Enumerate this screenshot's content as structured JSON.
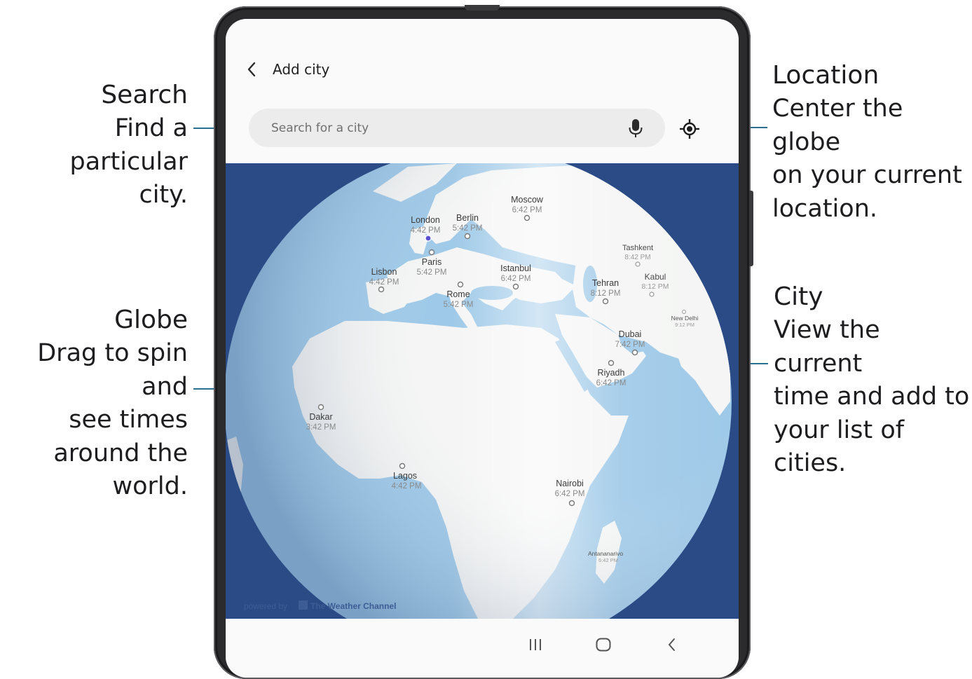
{
  "callouts": {
    "search": {
      "title": "Search",
      "desc1": "Find a particular",
      "desc2": "city."
    },
    "globe": {
      "title": "Globe",
      "desc1": "Drag to spin and",
      "desc2": "see times",
      "desc3": "around the",
      "desc4": "world."
    },
    "location": {
      "title": "Location",
      "desc1": "Center the globe",
      "desc2": "on your current",
      "desc3": "location."
    },
    "city": {
      "title": "City",
      "desc1": "View the current",
      "desc2": "time and add to",
      "desc3": "your list of",
      "desc4": "cities."
    }
  },
  "app": {
    "title": "Add city",
    "search_placeholder": "Search for a city",
    "powered_by": "powered by",
    "brand": "The Weather Channel"
  },
  "cities": [
    {
      "name": "Moscow",
      "time": "6:42 PM"
    },
    {
      "name": "London",
      "time": "4:42 PM"
    },
    {
      "name": "Berlin",
      "time": "5:42 PM"
    },
    {
      "name": "Tashkent",
      "time": "8:42 PM"
    },
    {
      "name": "Paris",
      "time": "5:42 PM"
    },
    {
      "name": "Lisbon",
      "time": "4:42 PM"
    },
    {
      "name": "Istanbul",
      "time": "6:42 PM"
    },
    {
      "name": "Kabul",
      "time": "8:12 PM"
    },
    {
      "name": "Tehran",
      "time": "8:12 PM"
    },
    {
      "name": "Rome",
      "time": "5:42 PM"
    },
    {
      "name": "New Delhi",
      "time": "9:12 PM"
    },
    {
      "name": "Dubai",
      "time": "7:42 PM"
    },
    {
      "name": "Riyadh",
      "time": "6:42 PM"
    },
    {
      "name": "Dakar",
      "time": "3:42 PM"
    },
    {
      "name": "Lagos",
      "time": "4:42 PM"
    },
    {
      "name": "Nairobi",
      "time": "6:42 PM"
    },
    {
      "name": "Antananarivo",
      "time": "6:42 PM"
    }
  ],
  "colors": {
    "map_background": "#2b4b86",
    "ocean_light": "#9ec9e8",
    "land": "#f4f5f4",
    "leader_line": "#2a6f8f"
  },
  "icons": {
    "back": "chevron-left-icon",
    "mic": "mic-icon",
    "location": "crosshair-icon",
    "recents": "recents-icon",
    "home": "home-icon",
    "nav_back": "back-icon"
  }
}
